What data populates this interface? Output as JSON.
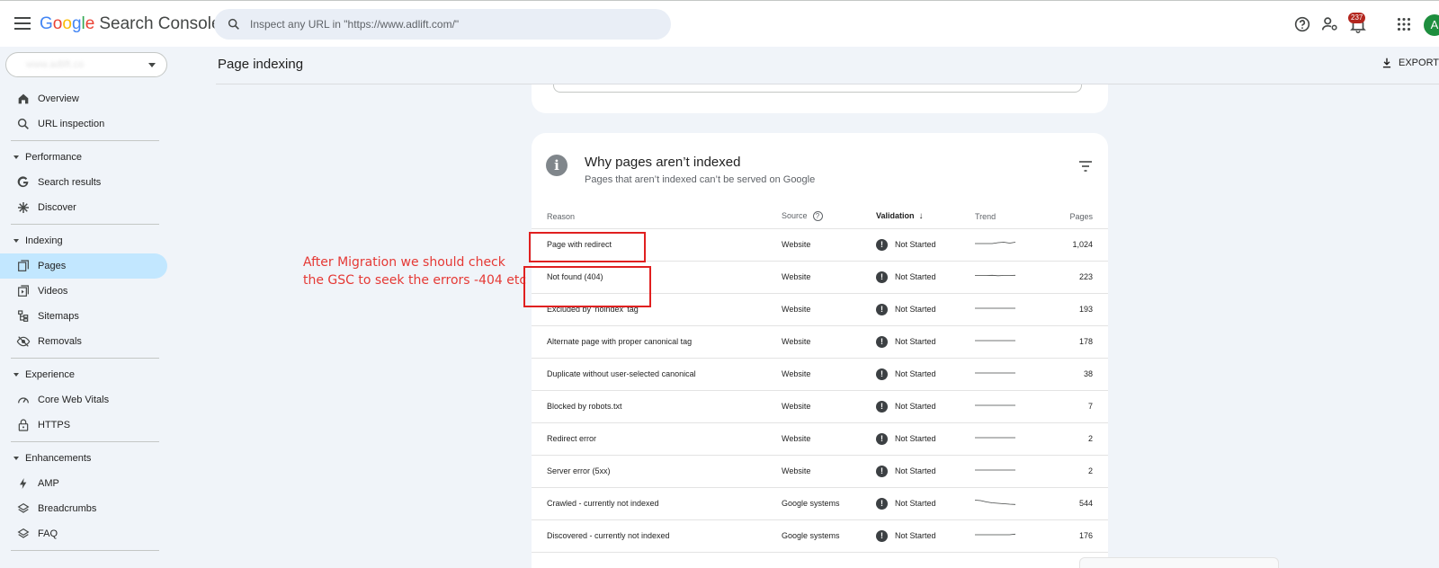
{
  "app": {
    "logo_letters": [
      {
        "ch": "G",
        "color": "#4285F4"
      },
      {
        "ch": "o",
        "color": "#EA4335"
      },
      {
        "ch": "o",
        "color": "#FBBC05"
      },
      {
        "ch": "g",
        "color": "#4285F4"
      },
      {
        "ch": "l",
        "color": "#34A853"
      },
      {
        "ch": "e",
        "color": "#EA4335"
      }
    ],
    "product_name": "Search Console",
    "search_placeholder": "Inspect any URL in \"https://www.adlift.com/\"",
    "notification_count": "237",
    "avatar_letter": "A",
    "property_text": "www.adlift.co"
  },
  "sidebar": {
    "overview": "Overview",
    "url_inspection": "URL inspection",
    "performance": "Performance",
    "search_results": "Search results",
    "discover": "Discover",
    "indexing": "Indexing",
    "pages": "Pages",
    "videos": "Videos",
    "sitemaps": "Sitemaps",
    "removals": "Removals",
    "experience": "Experience",
    "core_web_vitals": "Core Web Vitals",
    "https": "HTTPS",
    "enhancements": "Enhancements",
    "amp": "AMP",
    "breadcrumbs": "Breadcrumbs",
    "faq": "FAQ"
  },
  "header": {
    "title": "Page indexing",
    "export_label": "EXPORT"
  },
  "card": {
    "title": "Why pages aren’t indexed",
    "subtitle": "Pages that aren’t indexed can’t be served on Google",
    "columns": {
      "reason": "Reason",
      "source": "Source",
      "validation": "Validation",
      "trend": "Trend",
      "pages": "Pages"
    },
    "rows": [
      {
        "reason": "Page with redirect",
        "source": "Website",
        "validation": "Not Started",
        "pages": "1,024",
        "trend": [
          2,
          2,
          2,
          2,
          2.4,
          2.6,
          2.2,
          2.6
        ]
      },
      {
        "reason": "Not found (404)",
        "source": "Website",
        "validation": "Not Started",
        "pages": "223",
        "trend": [
          2.2,
          2.2,
          2.2,
          2.3,
          2.1,
          2.2,
          2.2,
          2.3
        ]
      },
      {
        "reason": "Excluded by ‘noindex’ tag",
        "source": "Website",
        "validation": "Not Started",
        "pages": "193",
        "trend": [
          2,
          2,
          2,
          2,
          2,
          2,
          2,
          2
        ]
      },
      {
        "reason": "Alternate page with proper canonical tag",
        "source": "Website",
        "validation": "Not Started",
        "pages": "178",
        "trend": [
          2,
          2,
          2,
          2,
          2,
          2,
          2,
          2
        ]
      },
      {
        "reason": "Duplicate without user-selected canonical",
        "source": "Website",
        "validation": "Not Started",
        "pages": "38",
        "trend": [
          2,
          2,
          2,
          2,
          2,
          2,
          2,
          2
        ]
      },
      {
        "reason": "Blocked by robots.txt",
        "source": "Website",
        "validation": "Not Started",
        "pages": "7",
        "trend": [
          2,
          2,
          2,
          2,
          2,
          2,
          2,
          2
        ]
      },
      {
        "reason": "Redirect error",
        "source": "Website",
        "validation": "Not Started",
        "pages": "2",
        "trend": [
          2,
          2,
          2,
          2,
          2,
          2,
          2,
          2
        ]
      },
      {
        "reason": "Server error (5xx)",
        "source": "Website",
        "validation": "Not Started",
        "pages": "2",
        "trend": [
          2,
          2,
          2,
          2,
          2,
          2,
          2,
          2
        ]
      },
      {
        "reason": "Crawled - currently not indexed",
        "source": "Google systems",
        "validation": "Not Started",
        "pages": "544",
        "trend": [
          3,
          2.8,
          2.2,
          1.8,
          1.6,
          1.4,
          1.2,
          1.1
        ]
      },
      {
        "reason": "Discovered - currently not indexed",
        "source": "Google systems",
        "validation": "Not Started",
        "pages": "176",
        "trend": [
          2,
          2,
          2,
          2,
          2,
          2,
          2,
          2.3
        ]
      }
    ]
  },
  "annotation": {
    "line1": "After Migration we should check",
    "line2": "the GSC to seek the errors -404 etc"
  },
  "colors": {
    "accent_active": "#c2e7ff",
    "highlight_red": "#e02020",
    "annotation_red": "#e53935",
    "avatar_green": "#1e8e3e",
    "badge_red": "#b3261e"
  },
  "icons": {
    "menu": "hamburger-icon",
    "search": "search-icon",
    "help": "help-icon",
    "settings": "user-settings-icon",
    "notifications": "bell-icon",
    "apps": "apps-grid-icon",
    "export": "download-icon",
    "info": "info-icon",
    "filter": "filter-icon"
  }
}
